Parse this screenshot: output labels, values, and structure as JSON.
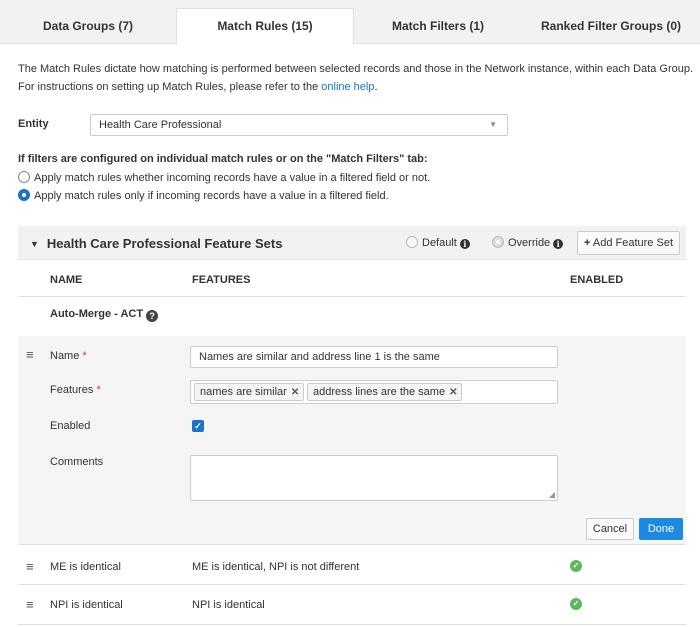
{
  "tabs": [
    {
      "label": "Data Groups (7)",
      "active": false
    },
    {
      "label": "Match Rules (15)",
      "active": true
    },
    {
      "label": "Match Filters (1)",
      "active": false
    },
    {
      "label": "Ranked Filter Groups (0)",
      "active": false
    }
  ],
  "description": {
    "line1": "The Match Rules dictate how matching is performed between selected records and those in the Network instance, within each Data Group.",
    "line2_prefix": "For instructions on setting up Match Rules, please refer to the ",
    "link": "online help",
    "line2_suffix": "."
  },
  "entity": {
    "label": "Entity",
    "value": "Health Care Professional"
  },
  "filters": {
    "title": "If filters are configured on individual match rules or on the \"Match Filters\" tab:",
    "options": [
      {
        "label": "Apply match rules whether incoming records have a value in a filtered field or not.",
        "selected": false
      },
      {
        "label": "Apply match rules only if incoming records have a value in a filtered field.",
        "selected": true
      }
    ]
  },
  "feature_sets": {
    "title": "Health Care Professional Feature Sets",
    "default_label": "Default",
    "override_label": "Override",
    "add_button": "Add Feature Set",
    "columns": {
      "name": "NAME",
      "features": "FEATURES",
      "enabled": "ENABLED"
    },
    "group_name": "Auto-Merge - ACT",
    "editor": {
      "name_label": "Name",
      "name_value": "Names are similar and address line 1 is the same",
      "features_label": "Features",
      "tags": [
        "names are similar",
        "address lines are the same"
      ],
      "enabled_label": "Enabled",
      "enabled": true,
      "comments_label": "Comments",
      "comments_value": "",
      "cancel": "Cancel",
      "done": "Done"
    },
    "rows": [
      {
        "name": "ME is identical",
        "features": "ME is identical, NPI is not different",
        "enabled": true
      },
      {
        "name": "NPI is identical",
        "features": "NPI is identical",
        "enabled": true
      }
    ]
  },
  "colors": {
    "accent": "#1b75c4",
    "done_button": "#1b8ae0",
    "enabled_check": "#5cb85c",
    "required": "#d9362b"
  }
}
